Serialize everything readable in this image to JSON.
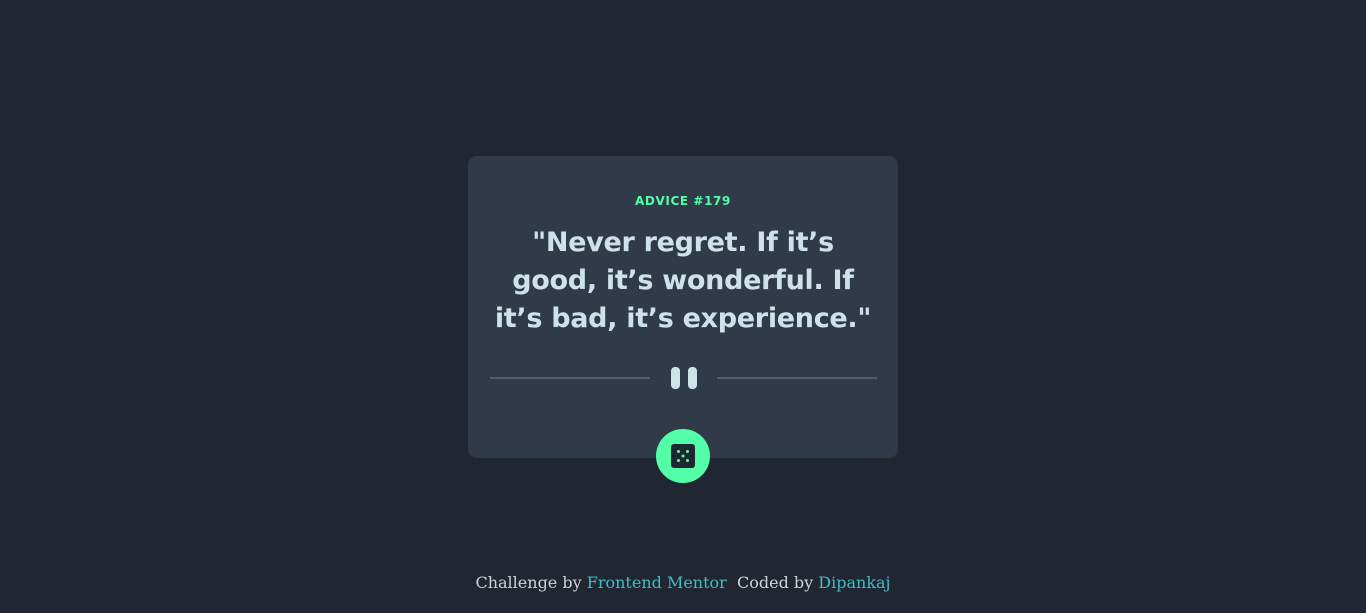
{
  "card": {
    "advice_label": "ADVICE #179",
    "advice_text": "\"Never regret. If it’s good, it’s wonderful. If it’s bad, it’s experience.\"",
    "divider_icon": "pause-icon",
    "dice_button_icon": "dice-icon"
  },
  "attribution": {
    "challenge_prefix": "Challenge by ",
    "challenge_link": "Frontend Mentor",
    "coded_prefix": "  Coded by ",
    "coded_link": "Dipankaj"
  },
  "colors": {
    "background": "#202632",
    "card": "#313a49",
    "accent_green": "#52ffa8",
    "text_light": "#cee3e9",
    "divider": "#4f5d74",
    "link": "#3fbfc2"
  }
}
